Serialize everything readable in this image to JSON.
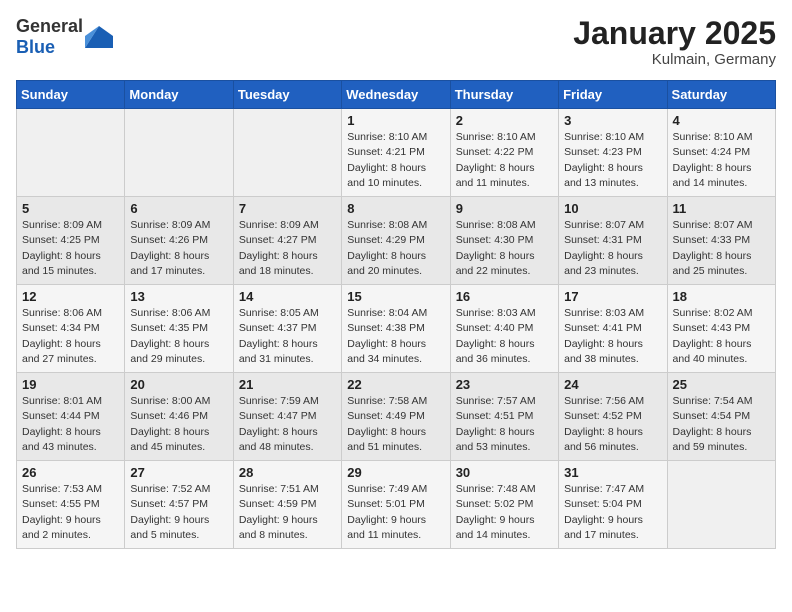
{
  "header": {
    "logo_general": "General",
    "logo_blue": "Blue",
    "month_title": "January 2025",
    "location": "Kulmain, Germany"
  },
  "days_of_week": [
    "Sunday",
    "Monday",
    "Tuesday",
    "Wednesday",
    "Thursday",
    "Friday",
    "Saturday"
  ],
  "weeks": [
    [
      {
        "day": "",
        "sunrise": "",
        "sunset": "",
        "daylight": ""
      },
      {
        "day": "",
        "sunrise": "",
        "sunset": "",
        "daylight": ""
      },
      {
        "day": "",
        "sunrise": "",
        "sunset": "",
        "daylight": ""
      },
      {
        "day": "1",
        "sunrise": "Sunrise: 8:10 AM",
        "sunset": "Sunset: 4:21 PM",
        "daylight": "Daylight: 8 hours and 10 minutes."
      },
      {
        "day": "2",
        "sunrise": "Sunrise: 8:10 AM",
        "sunset": "Sunset: 4:22 PM",
        "daylight": "Daylight: 8 hours and 11 minutes."
      },
      {
        "day": "3",
        "sunrise": "Sunrise: 8:10 AM",
        "sunset": "Sunset: 4:23 PM",
        "daylight": "Daylight: 8 hours and 13 minutes."
      },
      {
        "day": "4",
        "sunrise": "Sunrise: 8:10 AM",
        "sunset": "Sunset: 4:24 PM",
        "daylight": "Daylight: 8 hours and 14 minutes."
      }
    ],
    [
      {
        "day": "5",
        "sunrise": "Sunrise: 8:09 AM",
        "sunset": "Sunset: 4:25 PM",
        "daylight": "Daylight: 8 hours and 15 minutes."
      },
      {
        "day": "6",
        "sunrise": "Sunrise: 8:09 AM",
        "sunset": "Sunset: 4:26 PM",
        "daylight": "Daylight: 8 hours and 17 minutes."
      },
      {
        "day": "7",
        "sunrise": "Sunrise: 8:09 AM",
        "sunset": "Sunset: 4:27 PM",
        "daylight": "Daylight: 8 hours and 18 minutes."
      },
      {
        "day": "8",
        "sunrise": "Sunrise: 8:08 AM",
        "sunset": "Sunset: 4:29 PM",
        "daylight": "Daylight: 8 hours and 20 minutes."
      },
      {
        "day": "9",
        "sunrise": "Sunrise: 8:08 AM",
        "sunset": "Sunset: 4:30 PM",
        "daylight": "Daylight: 8 hours and 22 minutes."
      },
      {
        "day": "10",
        "sunrise": "Sunrise: 8:07 AM",
        "sunset": "Sunset: 4:31 PM",
        "daylight": "Daylight: 8 hours and 23 minutes."
      },
      {
        "day": "11",
        "sunrise": "Sunrise: 8:07 AM",
        "sunset": "Sunset: 4:33 PM",
        "daylight": "Daylight: 8 hours and 25 minutes."
      }
    ],
    [
      {
        "day": "12",
        "sunrise": "Sunrise: 8:06 AM",
        "sunset": "Sunset: 4:34 PM",
        "daylight": "Daylight: 8 hours and 27 minutes."
      },
      {
        "day": "13",
        "sunrise": "Sunrise: 8:06 AM",
        "sunset": "Sunset: 4:35 PM",
        "daylight": "Daylight: 8 hours and 29 minutes."
      },
      {
        "day": "14",
        "sunrise": "Sunrise: 8:05 AM",
        "sunset": "Sunset: 4:37 PM",
        "daylight": "Daylight: 8 hours and 31 minutes."
      },
      {
        "day": "15",
        "sunrise": "Sunrise: 8:04 AM",
        "sunset": "Sunset: 4:38 PM",
        "daylight": "Daylight: 8 hours and 34 minutes."
      },
      {
        "day": "16",
        "sunrise": "Sunrise: 8:03 AM",
        "sunset": "Sunset: 4:40 PM",
        "daylight": "Daylight: 8 hours and 36 minutes."
      },
      {
        "day": "17",
        "sunrise": "Sunrise: 8:03 AM",
        "sunset": "Sunset: 4:41 PM",
        "daylight": "Daylight: 8 hours and 38 minutes."
      },
      {
        "day": "18",
        "sunrise": "Sunrise: 8:02 AM",
        "sunset": "Sunset: 4:43 PM",
        "daylight": "Daylight: 8 hours and 40 minutes."
      }
    ],
    [
      {
        "day": "19",
        "sunrise": "Sunrise: 8:01 AM",
        "sunset": "Sunset: 4:44 PM",
        "daylight": "Daylight: 8 hours and 43 minutes."
      },
      {
        "day": "20",
        "sunrise": "Sunrise: 8:00 AM",
        "sunset": "Sunset: 4:46 PM",
        "daylight": "Daylight: 8 hours and 45 minutes."
      },
      {
        "day": "21",
        "sunrise": "Sunrise: 7:59 AM",
        "sunset": "Sunset: 4:47 PM",
        "daylight": "Daylight: 8 hours and 48 minutes."
      },
      {
        "day": "22",
        "sunrise": "Sunrise: 7:58 AM",
        "sunset": "Sunset: 4:49 PM",
        "daylight": "Daylight: 8 hours and 51 minutes."
      },
      {
        "day": "23",
        "sunrise": "Sunrise: 7:57 AM",
        "sunset": "Sunset: 4:51 PM",
        "daylight": "Daylight: 8 hours and 53 minutes."
      },
      {
        "day": "24",
        "sunrise": "Sunrise: 7:56 AM",
        "sunset": "Sunset: 4:52 PM",
        "daylight": "Daylight: 8 hours and 56 minutes."
      },
      {
        "day": "25",
        "sunrise": "Sunrise: 7:54 AM",
        "sunset": "Sunset: 4:54 PM",
        "daylight": "Daylight: 8 hours and 59 minutes."
      }
    ],
    [
      {
        "day": "26",
        "sunrise": "Sunrise: 7:53 AM",
        "sunset": "Sunset: 4:55 PM",
        "daylight": "Daylight: 9 hours and 2 minutes."
      },
      {
        "day": "27",
        "sunrise": "Sunrise: 7:52 AM",
        "sunset": "Sunset: 4:57 PM",
        "daylight": "Daylight: 9 hours and 5 minutes."
      },
      {
        "day": "28",
        "sunrise": "Sunrise: 7:51 AM",
        "sunset": "Sunset: 4:59 PM",
        "daylight": "Daylight: 9 hours and 8 minutes."
      },
      {
        "day": "29",
        "sunrise": "Sunrise: 7:49 AM",
        "sunset": "Sunset: 5:01 PM",
        "daylight": "Daylight: 9 hours and 11 minutes."
      },
      {
        "day": "30",
        "sunrise": "Sunrise: 7:48 AM",
        "sunset": "Sunset: 5:02 PM",
        "daylight": "Daylight: 9 hours and 14 minutes."
      },
      {
        "day": "31",
        "sunrise": "Sunrise: 7:47 AM",
        "sunset": "Sunset: 5:04 PM",
        "daylight": "Daylight: 9 hours and 17 minutes."
      },
      {
        "day": "",
        "sunrise": "",
        "sunset": "",
        "daylight": ""
      }
    ]
  ]
}
